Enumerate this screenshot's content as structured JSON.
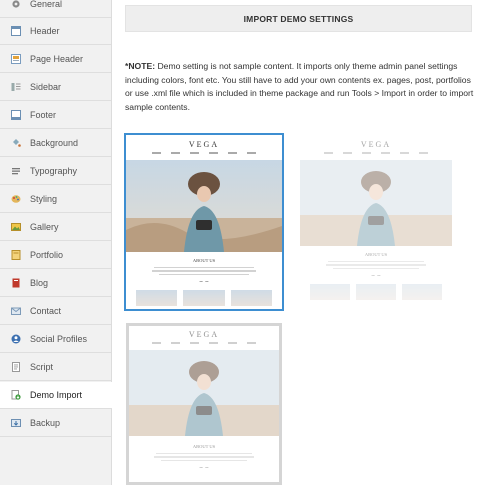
{
  "sidebar": {
    "items": [
      {
        "label": "General",
        "icon": "gear-icon"
      },
      {
        "label": "Header",
        "icon": "header-icon"
      },
      {
        "label": "Page Header",
        "icon": "page-header-icon"
      },
      {
        "label": "Sidebar",
        "icon": "sidebar-icon"
      },
      {
        "label": "Footer",
        "icon": "footer-icon"
      },
      {
        "label": "Background",
        "icon": "paint-bucket-icon"
      },
      {
        "label": "Typography",
        "icon": "typography-icon"
      },
      {
        "label": "Styling",
        "icon": "palette-icon"
      },
      {
        "label": "Gallery",
        "icon": "gallery-icon"
      },
      {
        "label": "Portfolio",
        "icon": "portfolio-icon"
      },
      {
        "label": "Blog",
        "icon": "book-icon"
      },
      {
        "label": "Contact",
        "icon": "mail-icon"
      },
      {
        "label": "Social Profiles",
        "icon": "social-icon"
      },
      {
        "label": "Script",
        "icon": "script-icon"
      },
      {
        "label": "Demo Import",
        "icon": "import-icon"
      },
      {
        "label": "Backup",
        "icon": "backup-icon"
      }
    ],
    "active": "Demo Import"
  },
  "main": {
    "title": "IMPORT DEMO SETTINGS",
    "note_label": "*NOTE:",
    "note_text": " Demo setting is not sample content. It imports only theme admin panel settings including colors, font etc. You still have to add your own contents ex. pages, post, portfolios or use .xml file which is included in theme package and run Tools > Import in order to import sample contents."
  },
  "demos": [
    {
      "logo": "VEGA",
      "about": "ABOUT US",
      "selected": true
    },
    {
      "logo": "VEGA",
      "about": "ABOUT US",
      "selected": false
    },
    {
      "logo": "VEGA",
      "about": "ABOUT US",
      "selected": false
    }
  ],
  "colors": {
    "accent": "#3d8ed1",
    "sidebar_bg": "#f1f1f1",
    "header_bg": "#eeeeee"
  }
}
